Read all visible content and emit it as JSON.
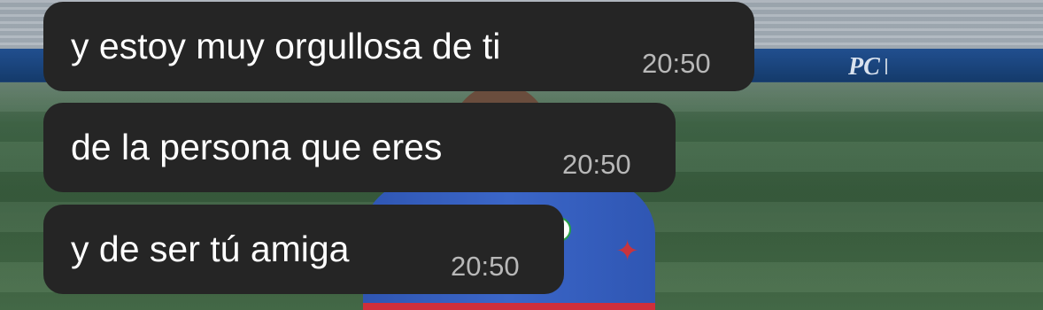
{
  "chat": {
    "messages": [
      {
        "text": "y estoy muy orgullosa de ti",
        "time": "20:50"
      },
      {
        "text": "de la persona que eres",
        "time": "20:50"
      },
      {
        "text": "y de ser tú amiga",
        "time": "20:50"
      }
    ]
  },
  "background": {
    "ad_text": "PC"
  }
}
